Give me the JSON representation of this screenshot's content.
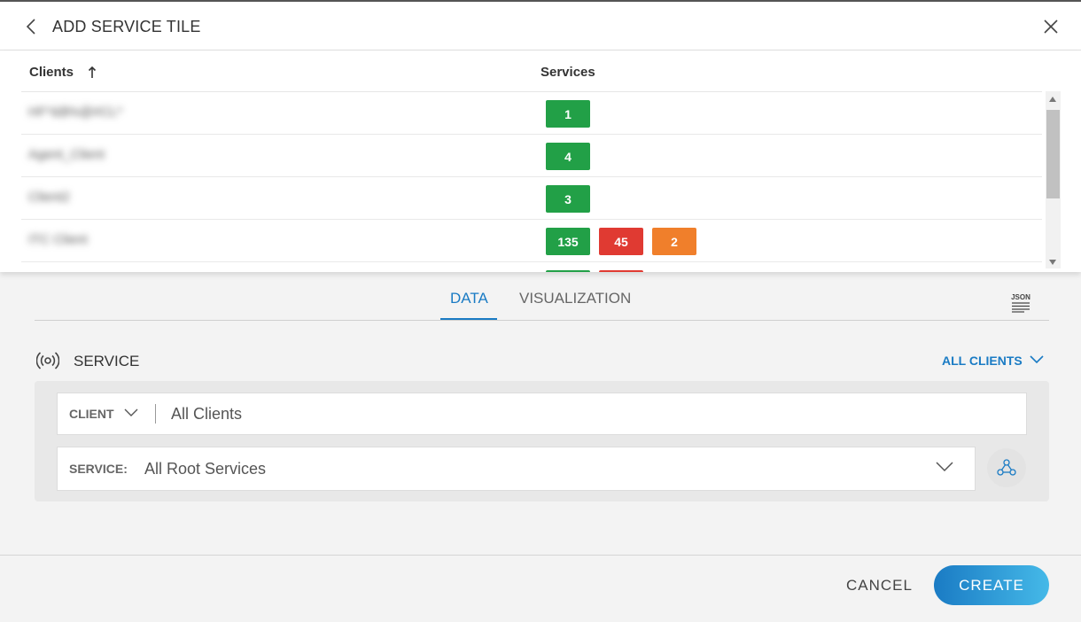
{
  "header": {
    "title": "ADD SERVICE TILE"
  },
  "table": {
    "columns": {
      "clients": "Clients",
      "services": "Services"
    },
    "rows": [
      {
        "client": "HF*&$%@#CL*",
        "badges": [
          {
            "value": "1",
            "status": "green"
          }
        ]
      },
      {
        "client": "Agent_Client",
        "badges": [
          {
            "value": "4",
            "status": "green"
          }
        ]
      },
      {
        "client": "Client2",
        "badges": [
          {
            "value": "3",
            "status": "green"
          }
        ]
      },
      {
        "client": "ITC Client",
        "badges": [
          {
            "value": "135",
            "status": "green"
          },
          {
            "value": "45",
            "status": "red"
          },
          {
            "value": "2",
            "status": "orange"
          }
        ]
      }
    ]
  },
  "tabs": {
    "data": "DATA",
    "visualization": "VISUALIZATION",
    "active": "data"
  },
  "json_icon_label": "JSON",
  "service_section": {
    "title": "SERVICE",
    "scope_link": "ALL CLIENTS",
    "client_select_label": "CLIENT",
    "client_value": "All Clients",
    "service_label": "SERVICE:",
    "service_value": "All Root Services"
  },
  "footer": {
    "cancel": "CANCEL",
    "create": "CREATE"
  },
  "colors": {
    "accent": "#1a7bc4",
    "green": "#22a047",
    "red": "#e03a32",
    "orange": "#f07f2b"
  }
}
